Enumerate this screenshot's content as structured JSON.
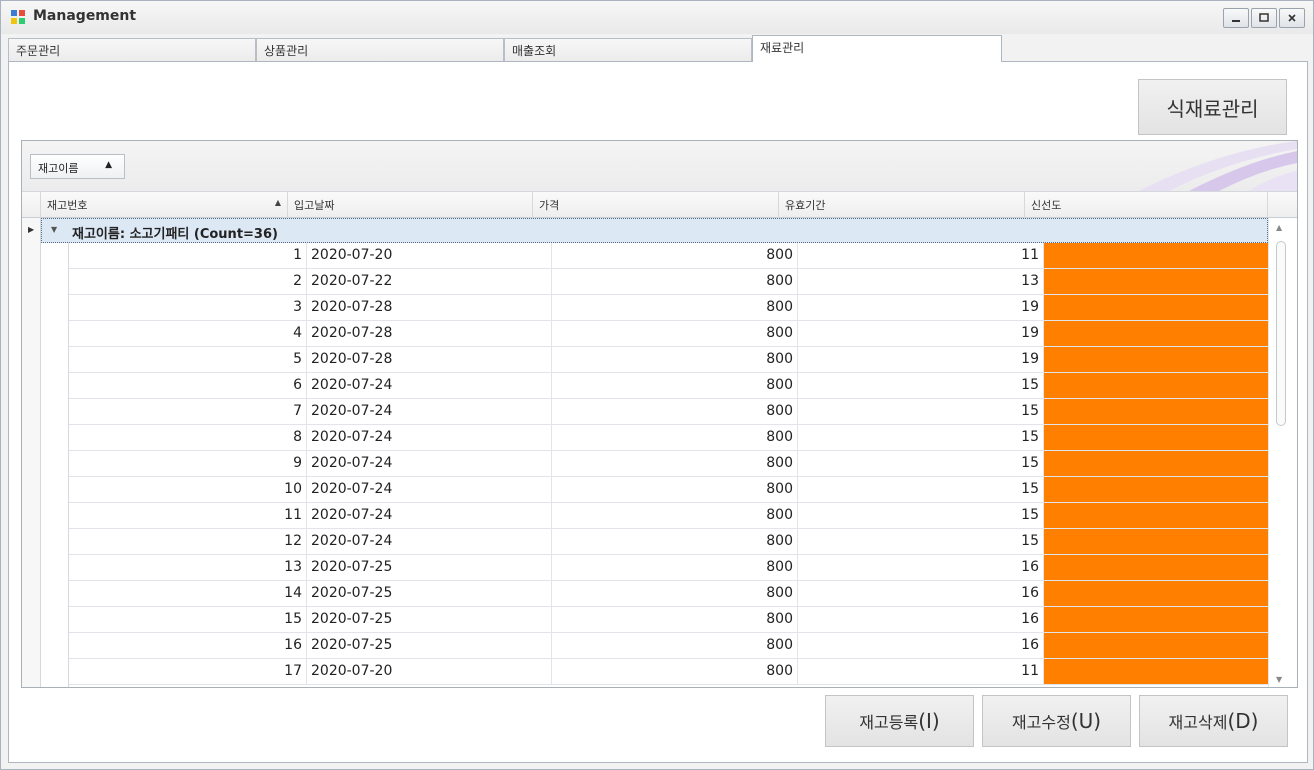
{
  "window": {
    "title": "Management"
  },
  "tabs": [
    {
      "label": "주문관리"
    },
    {
      "label": "상품관리"
    },
    {
      "label": "매출조회"
    },
    {
      "label": "재료관리"
    }
  ],
  "buttons": {
    "ingredient": "식재료관리",
    "register_prefix": "재고등록",
    "register_key": "(I)",
    "modify_prefix": "재고수정",
    "modify_key": "(U)",
    "delete_prefix": "재고삭제",
    "delete_key": "(D)"
  },
  "grid": {
    "group_chip": "재고이름",
    "columns": [
      "재고번호",
      "입고날짜",
      "가격",
      "유효기간",
      "신선도"
    ],
    "group_row": "재고이름: 소고기패티 (Count=36)",
    "freshness_color": "#ff8000",
    "rows": [
      {
        "id": "1",
        "date": "2020-07-20",
        "price": "800",
        "expiry": "11"
      },
      {
        "id": "2",
        "date": "2020-07-22",
        "price": "800",
        "expiry": "13"
      },
      {
        "id": "3",
        "date": "2020-07-28",
        "price": "800",
        "expiry": "19"
      },
      {
        "id": "4",
        "date": "2020-07-28",
        "price": "800",
        "expiry": "19"
      },
      {
        "id": "5",
        "date": "2020-07-28",
        "price": "800",
        "expiry": "19"
      },
      {
        "id": "6",
        "date": "2020-07-24",
        "price": "800",
        "expiry": "15"
      },
      {
        "id": "7",
        "date": "2020-07-24",
        "price": "800",
        "expiry": "15"
      },
      {
        "id": "8",
        "date": "2020-07-24",
        "price": "800",
        "expiry": "15"
      },
      {
        "id": "9",
        "date": "2020-07-24",
        "price": "800",
        "expiry": "15"
      },
      {
        "id": "10",
        "date": "2020-07-24",
        "price": "800",
        "expiry": "15"
      },
      {
        "id": "11",
        "date": "2020-07-24",
        "price": "800",
        "expiry": "15"
      },
      {
        "id": "12",
        "date": "2020-07-24",
        "price": "800",
        "expiry": "15"
      },
      {
        "id": "13",
        "date": "2020-07-25",
        "price": "800",
        "expiry": "16"
      },
      {
        "id": "14",
        "date": "2020-07-25",
        "price": "800",
        "expiry": "16"
      },
      {
        "id": "15",
        "date": "2020-07-25",
        "price": "800",
        "expiry": "16"
      },
      {
        "id": "16",
        "date": "2020-07-25",
        "price": "800",
        "expiry": "16"
      },
      {
        "id": "17",
        "date": "2020-07-20",
        "price": "800",
        "expiry": "11"
      }
    ]
  }
}
